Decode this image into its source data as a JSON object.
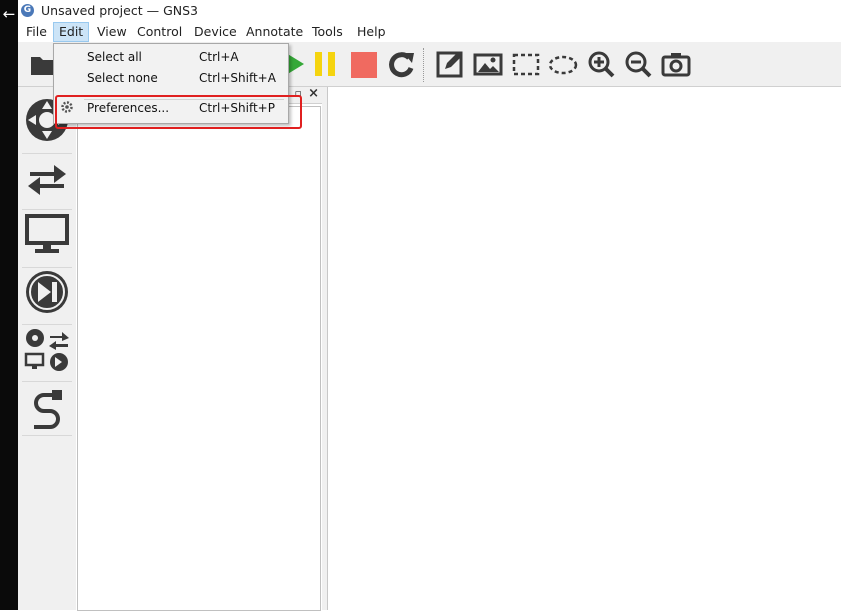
{
  "window": {
    "title": "Unsaved project — GNS3"
  },
  "menubar": {
    "items": [
      {
        "label": "File",
        "active": false
      },
      {
        "label": "Edit",
        "active": true
      },
      {
        "label": "View",
        "active": false
      },
      {
        "label": "Control",
        "active": false
      },
      {
        "label": "Device",
        "active": false
      },
      {
        "label": "Annotate",
        "active": false
      },
      {
        "label": "Tools",
        "active": false
      },
      {
        "label": "Help",
        "active": false
      }
    ]
  },
  "edit_menu": {
    "items": [
      {
        "label": "Select all",
        "shortcut": "Ctrl+A"
      },
      {
        "label": "Select none",
        "shortcut": "Ctrl+Shift+A"
      },
      {
        "label": "Preferences...",
        "shortcut": "Ctrl+Shift+P",
        "icon": "gear-icon",
        "highlighted": true
      }
    ]
  },
  "toolbar": {
    "buttons": [
      "open-folder-icon",
      "start-icon",
      "pause-icon",
      "stop-icon",
      "reload-icon",
      "add-note-icon",
      "insert-image-icon",
      "draw-rectangle-icon",
      "draw-ellipse-icon",
      "zoom-in-icon",
      "zoom-out-icon",
      "screenshot-icon"
    ]
  },
  "device_bar": {
    "buttons": [
      "router-icon",
      "switch-icon",
      "end-device-icon",
      "security-device-icon",
      "all-devices-icon",
      "add-link-icon"
    ]
  },
  "dock": {
    "float_glyph": "▫",
    "close_glyph": "×"
  },
  "colors": {
    "start": "#35a838",
    "pause": "#f5d40f",
    "stop": "#f06a60",
    "icon": "#3a3a3a",
    "annotation": "#e02020",
    "menu_active": "#cce4f7"
  }
}
